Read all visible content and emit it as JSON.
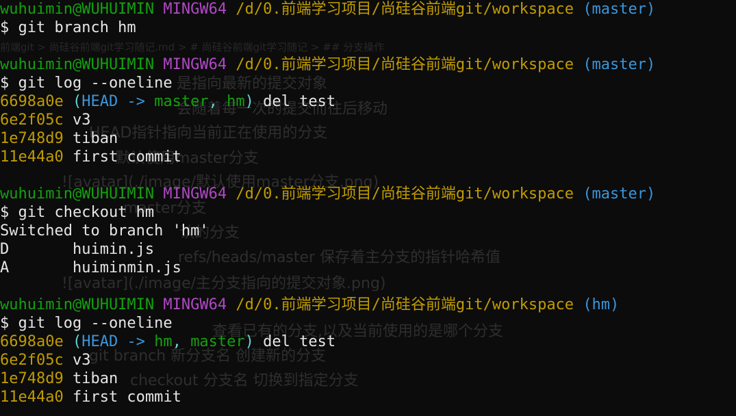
{
  "prompt_lines": [
    {
      "user": "wuhuimin@WUHUIMIN",
      "system": "MINGW64",
      "path": "/d/0.前端学习项目/尚硅谷前端git/workspace",
      "branch": "(master)"
    },
    {
      "user": "wuhuimin@WUHUIMIN",
      "system": "MINGW64",
      "path": "/d/0.前端学习项目/尚硅谷前端git/workspace",
      "branch": "(master)"
    },
    {
      "user": "wuhuimin@WUHUIMIN",
      "system": "MINGW64",
      "path": "/d/0.前端学习项目/尚硅谷前端git/workspace",
      "branch": "(master)"
    },
    {
      "user": "wuhuimin@WUHUIMIN",
      "system": "MINGW64",
      "path": "/d/0.前端学习项目/尚硅谷前端git/workspace",
      "branch": "(hm)"
    }
  ],
  "commands": [
    "$ git branch hm",
    "$ git log --oneline",
    "$ git checkout hm",
    "$ git log --oneline"
  ],
  "log1": [
    {
      "hash": "6698a0e",
      "decor_open": "(",
      "head": "HEAD",
      "arrow": " -> ",
      "b1": "master",
      "sep": ", ",
      "b2": "hm",
      "decor_close": ")",
      "msg": " del test"
    },
    {
      "hash": "6e2f05c",
      "msg": " v3"
    },
    {
      "hash": "1e748d9",
      "msg": " tiban"
    },
    {
      "hash": "11e44a0",
      "msg": " first commit"
    }
  ],
  "checkout_output": {
    "switched": "Switched to branch 'hm'",
    "files": [
      {
        "status": "D",
        "name": "huimin.js"
      },
      {
        "status": "A",
        "name": "huiminmin.js"
      }
    ]
  },
  "log2": [
    {
      "hash": "6698a0e",
      "decor_open": "(",
      "head": "HEAD",
      "arrow": " -> ",
      "b1": "hm",
      "sep": ", ",
      "b2": "master",
      "decor_close": ")",
      "msg": " del test"
    },
    {
      "hash": "6e2f05c",
      "msg": " v3"
    },
    {
      "hash": "1e748d9",
      "msg": " tiban"
    },
    {
      "hash": "11e44a0",
      "msg": " first commit"
    }
  ],
  "ghost": {
    "breadcrumb": "前端git > 尚硅谷前端git学习随记.md > # 尚硅谷前端git学习随记 > ## 分支操作",
    "lines": [
      "是指向最新的提交对象",
      "会随着每一次的提交而往后移动",
      "HEAD指针指向当前正在使用的分支",
      "默认使用master分支",
      "![avatar](./image/默认使用master分支.png)",
      "master分支",
      "认的分支",
      "refs/heads/master 保存着主分支的指针哈希值",
      "![avatar](./image/主分支指向的提交对象.png)",
      "查看已有的分支,以及当前使用的是哪个分支",
      "git branch 新分支名 创建新的分支",
      "checkout 分支名 切换到指定分支"
    ]
  }
}
